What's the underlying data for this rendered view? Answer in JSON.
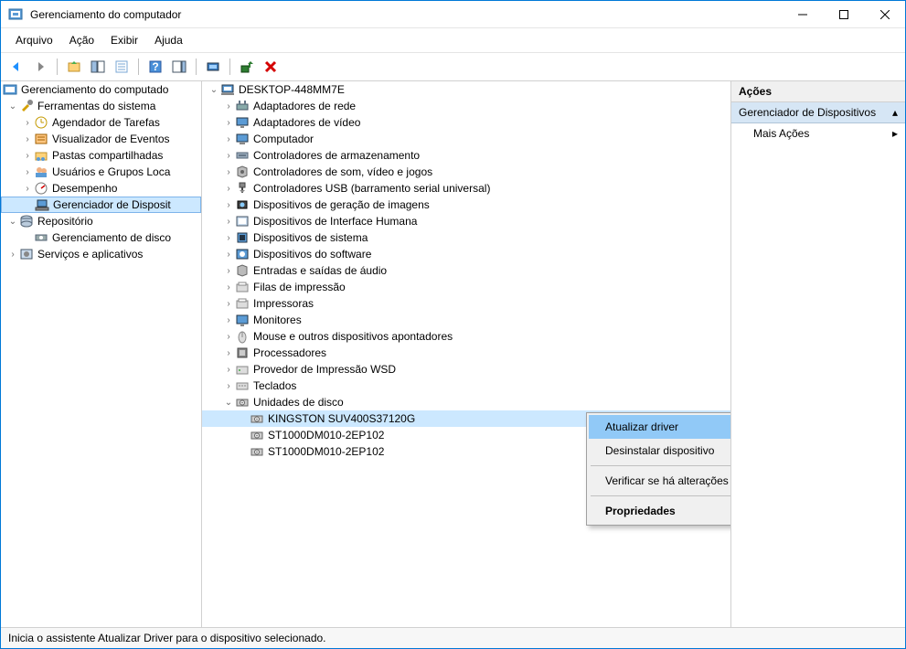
{
  "window": {
    "title": "Gerenciamento do computador"
  },
  "menu": {
    "file": "Arquivo",
    "action": "Ação",
    "view": "Exibir",
    "help": "Ajuda"
  },
  "left_tree": {
    "root": "Gerenciamento do computado",
    "tools": "Ferramentas do sistema",
    "tools_items": {
      "scheduler": "Agendador de Tarefas",
      "eventviewer": "Visualizador de Eventos",
      "shared": "Pastas compartilhadas",
      "users": "Usuários e Grupos Loca",
      "perf": "Desempenho",
      "devmgr": "Gerenciador de Disposit"
    },
    "storage": "Repositório",
    "storage_items": {
      "diskmgr": "Gerenciamento de disco"
    },
    "services": "Serviços e aplicativos"
  },
  "device_tree": {
    "root": "DESKTOP-448MM7E",
    "categories": [
      "Adaptadores de rede",
      "Adaptadores de vídeo",
      "Computador",
      "Controladores de armazenamento",
      "Controladores de som, vídeo e jogos",
      "Controladores USB (barramento serial universal)",
      "Dispositivos de geração de imagens",
      "Dispositivos de Interface Humana",
      "Dispositivos de sistema",
      "Dispositivos do software",
      "Entradas e saídas de áudio",
      "Filas de impressão",
      "Impressoras",
      "Monitores",
      "Mouse e outros dispositivos apontadores",
      "Processadores",
      "Provedor de Impressão WSD",
      "Teclados"
    ],
    "disk_category": "Unidades de disco",
    "disks": [
      "KINGSTON SUV400S37120G",
      "ST1000DM010-2EP102",
      "ST1000DM010-2EP102"
    ]
  },
  "context_menu": {
    "update": "Atualizar driver",
    "uninstall": "Desinstalar dispositivo",
    "scan": "Verificar se há alterações de hardware",
    "properties": "Propriedades"
  },
  "actions_pane": {
    "header": "Ações",
    "section": "Gerenciador de Dispositivos",
    "more": "Mais Ações"
  },
  "statusbar": {
    "text": "Inicia o assistente Atualizar Driver para o dispositivo selecionado."
  }
}
